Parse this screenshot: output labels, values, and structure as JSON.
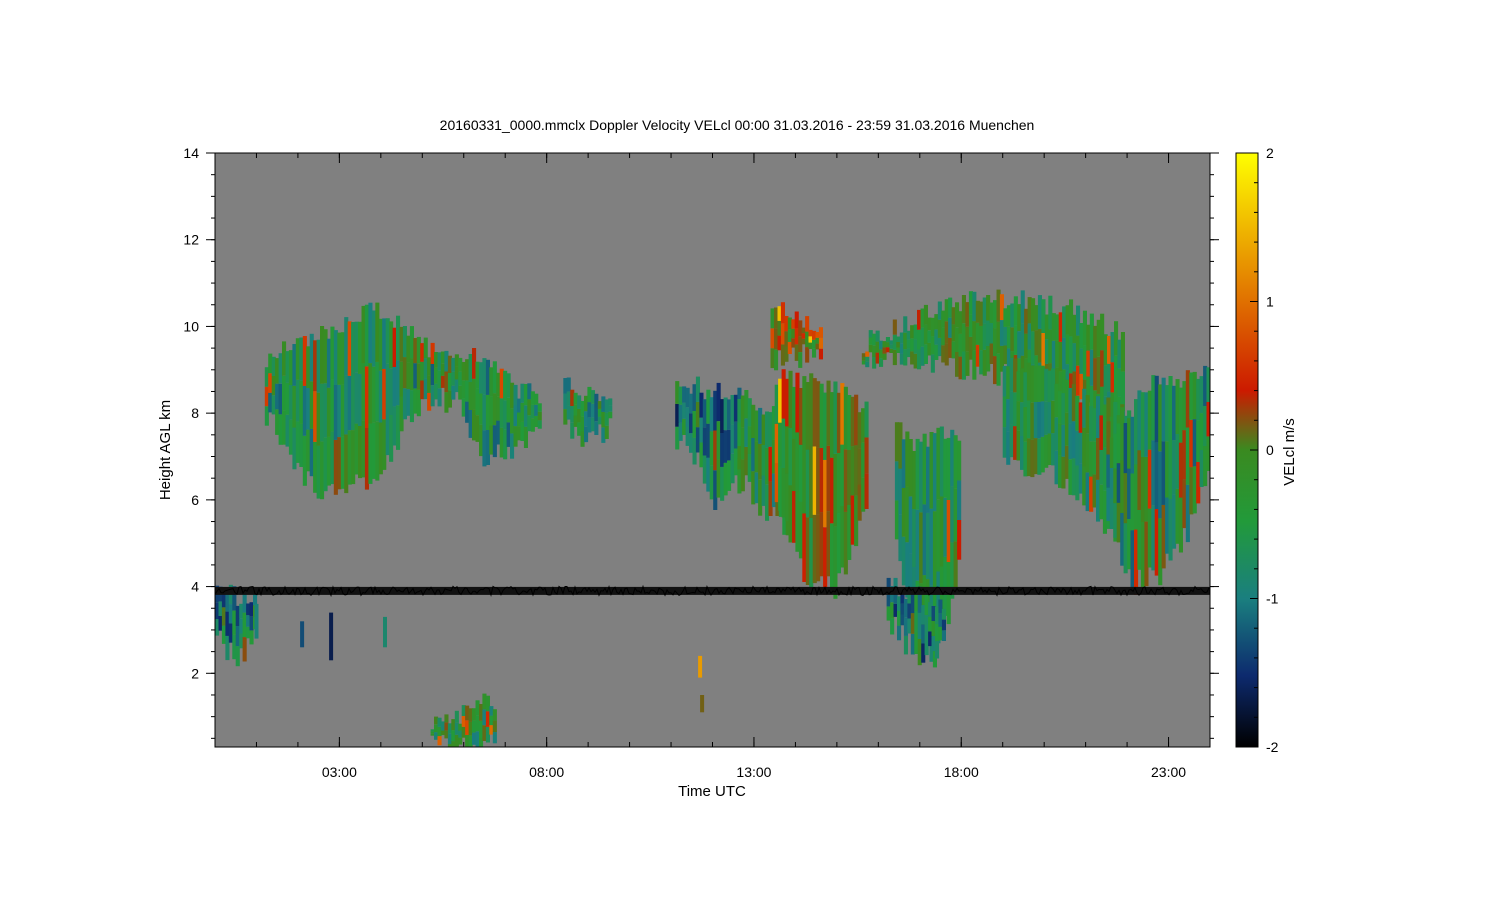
{
  "chart_data": {
    "type": "heatmap",
    "title": "20160331_0000.mmclx Doppler Velocity VELcl   00:00 31.03.2016 - 23:59 31.03.2016 Muenchen",
    "xlabel": "Time UTC",
    "ylabel": "Height AGL km",
    "colorbar_label": "VELcl m/s",
    "xlim_hours": [
      0,
      24
    ],
    "ylim_km": [
      0.3,
      14
    ],
    "x_ticks": [
      {
        "value": 3,
        "label": "03:00"
      },
      {
        "value": 8,
        "label": "08:00"
      },
      {
        "value": 13,
        "label": "13:00"
      },
      {
        "value": 18,
        "label": "18:00"
      },
      {
        "value": 23,
        "label": "23:00"
      }
    ],
    "y_ticks": [
      {
        "value": 2,
        "label": "2"
      },
      {
        "value": 4,
        "label": "4"
      },
      {
        "value": 6,
        "label": "6"
      },
      {
        "value": 8,
        "label": "8"
      },
      {
        "value": 10,
        "label": "10"
      },
      {
        "value": 12,
        "label": "12"
      },
      {
        "value": 14,
        "label": "14"
      }
    ],
    "colorbar_range": [
      -2,
      2
    ],
    "colorbar_ticks": [
      {
        "value": -2,
        "label": "-2"
      },
      {
        "value": -1,
        "label": "-1"
      },
      {
        "value": 0,
        "label": "0"
      },
      {
        "value": 1,
        "label": "1"
      },
      {
        "value": 2,
        "label": "2"
      }
    ],
    "colormap": [
      "#000000",
      "#0d2a6e",
      "#1a7f7f",
      "#229a3a",
      "#3a8a20",
      "#cc1a00",
      "#e07000",
      "#ffff00"
    ],
    "background_color": "#808080",
    "noise_line_height_km": 3.9,
    "cloud_regions": [
      {
        "t0": 1.2,
        "t1": 7.8,
        "top": [
          9.3,
          9.5,
          9.8,
          10.2,
          10.4,
          10.0,
          9.4,
          9.2,
          9.3,
          8.6,
          8.4
        ],
        "base": [
          8.0,
          6.8,
          6.2,
          6.4,
          6.6,
          7.6,
          8.4,
          8.2,
          7.0,
          7.2,
          7.8
        ],
        "mean": -0.4
      },
      {
        "t0": 8.4,
        "t1": 9.5,
        "top": [
          8.8,
          8.4,
          8.4,
          8.2
        ],
        "base": [
          7.8,
          7.2,
          7.4,
          7.6
        ],
        "mean": -0.4
      },
      {
        "t0": 11.1,
        "t1": 12.6,
        "top": [
          8.8,
          8.6,
          8.5,
          8.4
        ],
        "base": [
          7.4,
          6.8,
          5.9,
          6.4
        ],
        "mean": -0.9
      },
      {
        "t0": 12.6,
        "t1": 14.4,
        "top": [
          8.4,
          8.2,
          8.4,
          8.6
        ],
        "base": [
          6.6,
          5.8,
          5.4,
          6.0
        ],
        "mean": -0.3
      },
      {
        "t0": 13.5,
        "t1": 15.7,
        "top": [
          8.8,
          8.8,
          8.6,
          8.0
        ],
        "base": [
          6.2,
          4.2,
          4.0,
          6.0
        ],
        "mean": 0.2
      },
      {
        "t0": 16.4,
        "t1": 17.9,
        "top": [
          7.8,
          7.2,
          7.6,
          7.4
        ],
        "base": [
          5.0,
          2.6,
          2.4,
          4.4
        ],
        "mean": -0.3
      },
      {
        "t0": 16.2,
        "t1": 17.6,
        "top": [
          4.0,
          3.8,
          3.6
        ],
        "base": [
          3.2,
          2.4,
          2.6
        ],
        "mean": -0.8
      },
      {
        "t0": 13.4,
        "t1": 14.6,
        "top": [
          10.4,
          10.2,
          9.8
        ],
        "base": [
          9.2,
          9.3,
          9.4
        ],
        "mean": 0.5
      },
      {
        "t0": 15.6,
        "t1": 21.9,
        "top": [
          9.6,
          10.2,
          10.6,
          10.6,
          10.4,
          9.8
        ],
        "base": [
          9.1,
          9.2,
          9.0,
          8.8,
          8.2,
          7.4
        ],
        "mean": -0.1
      },
      {
        "t0": 19.0,
        "t1": 22.4,
        "top": [
          9.2,
          8.8,
          8.2,
          7.8
        ],
        "base": [
          7.0,
          6.6,
          5.6,
          4.8
        ],
        "mean": -0.2
      },
      {
        "t0": 21.5,
        "t1": 24.0,
        "top": [
          7.6,
          8.2,
          8.8,
          8.8,
          8.9
        ],
        "base": [
          5.4,
          4.1,
          4.2,
          5.2,
          6.6
        ],
        "mean": -0.5
      },
      {
        "t0": 0.0,
        "t1": 1.0,
        "top": [
          3.9,
          3.8,
          3.7
        ],
        "base": [
          2.8,
          2.3,
          3.0
        ],
        "mean": -0.8
      },
      {
        "t0": 5.2,
        "t1": 6.7,
        "top": [
          0.9,
          1.1,
          1.4
        ],
        "base": [
          0.3,
          0.3,
          0.3
        ],
        "mean": -0.2
      }
    ],
    "streaks": [
      {
        "t": 1.0,
        "top": 3.6,
        "base": 2.8,
        "mean": -0.8
      },
      {
        "t": 2.1,
        "top": 3.2,
        "base": 2.6,
        "mean": -1.2
      },
      {
        "t": 2.8,
        "top": 3.4,
        "base": 2.3,
        "mean": -1.6
      },
      {
        "t": 4.1,
        "top": 3.3,
        "base": 2.6,
        "mean": -0.7
      },
      {
        "t": 11.7,
        "top": 2.4,
        "base": 1.9,
        "mean": 1.6
      },
      {
        "t": 11.75,
        "top": 1.5,
        "base": 1.1,
        "mean": 0.5
      }
    ],
    "grid": false
  }
}
